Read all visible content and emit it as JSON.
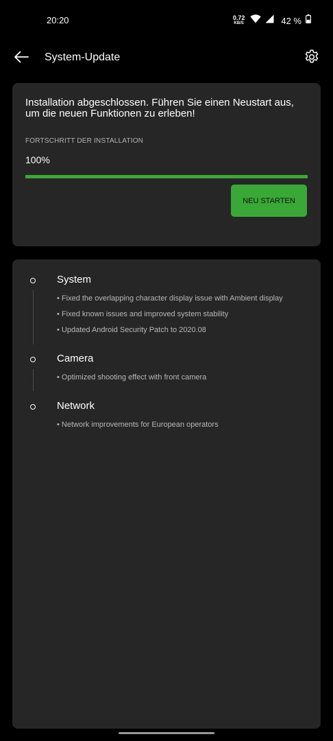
{
  "status_bar": {
    "time": "20:20",
    "net_speed_value": "0.72",
    "net_speed_unit": "KB/S",
    "battery_text": "42 %",
    "battery_level": 0.42
  },
  "app_bar": {
    "title": "System-Update"
  },
  "install_card": {
    "message": "Installation abgeschlossen. Führen Sie einen Neustart aus, um die neuen Funktionen zu erleben!",
    "progress_label": "FORTSCHRITT DER INSTALLATION",
    "progress_text": "100%",
    "progress_fraction": 1.0,
    "restart_label": "NEU STARTEN"
  },
  "release_notes": {
    "sections": [
      {
        "title": "System",
        "items": [
          "• Fixed the overlapping character display issue with Ambient display",
          "• Fixed known issues and improved system stability",
          "• Updated Android Security Patch to 2020.08"
        ]
      },
      {
        "title": "Camera",
        "items": [
          "• Optimized shooting effect with front camera"
        ]
      },
      {
        "title": "Network",
        "items": [
          "• Network improvements for European operators"
        ]
      }
    ]
  },
  "colors": {
    "accent": "#3aa837",
    "card_background": "#262626",
    "page_background": "#000000"
  }
}
